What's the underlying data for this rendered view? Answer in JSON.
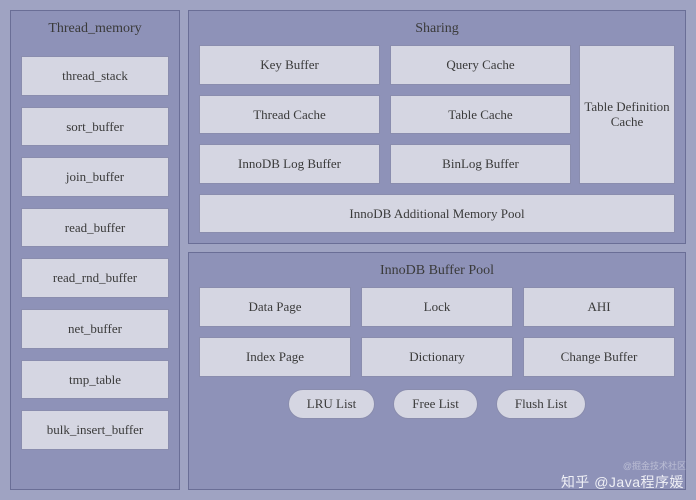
{
  "thread_memory": {
    "title": "Thread_memory",
    "items": [
      "thread_stack",
      "sort_buffer",
      "join_buffer",
      "read_buffer",
      "read_rnd_buffer",
      "net_buffer",
      "tmp_table",
      "bulk_insert_buffer"
    ]
  },
  "sharing": {
    "title": "Sharing",
    "grid": [
      "Key Buffer",
      "Query Cache",
      "Thread Cache",
      "Table Cache",
      "InnoDB Log Buffer",
      "BinLog Buffer"
    ],
    "tdc": "Table Definition Cache",
    "wide": "InnoDB Additional Memory Pool"
  },
  "innodb": {
    "title": "InnoDB Buffer Pool",
    "grid": [
      "Data Page",
      "Lock",
      "AHI",
      "Index Page",
      "Dictionary",
      "Change Buffer"
    ],
    "pills": [
      "LRU List",
      "Free List",
      "Flush List"
    ]
  },
  "watermark": "知乎 @Java程序媛",
  "footnote": "@掘金技术社区"
}
